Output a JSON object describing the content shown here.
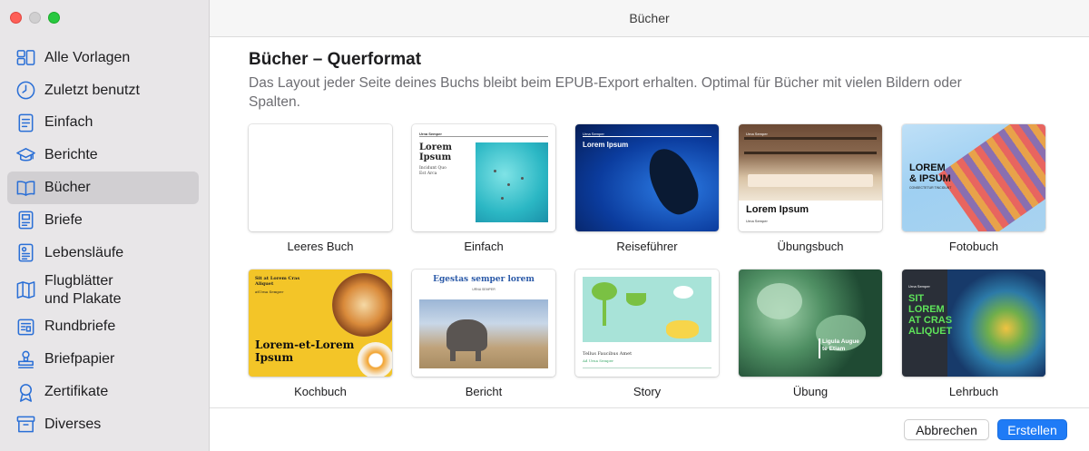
{
  "window": {
    "title": "Bücher"
  },
  "sidebar": {
    "items": [
      {
        "label": "Alle Vorlagen",
        "icon": "grid-icon"
      },
      {
        "label": "Zuletzt benutzt",
        "icon": "clock-icon"
      },
      {
        "label": "Einfach",
        "icon": "document-icon"
      },
      {
        "label": "Berichte",
        "icon": "graduation-cap-icon"
      },
      {
        "label": "Bücher",
        "icon": "book-icon",
        "selected": true
      },
      {
        "label": "Briefe",
        "icon": "letter-icon"
      },
      {
        "label": "Lebensläufe",
        "icon": "resume-icon"
      },
      {
        "label": "Flugblätter\nund Plakate",
        "label_line1": "Flugblätter",
        "label_line2": "und Plakate",
        "icon": "map-icon"
      },
      {
        "label": "Rundbriefe",
        "icon": "newsletter-icon"
      },
      {
        "label": "Briefpapier",
        "icon": "stamp-icon"
      },
      {
        "label": "Zertifikate",
        "icon": "ribbon-icon"
      },
      {
        "label": "Diverses",
        "icon": "archive-box-icon"
      }
    ]
  },
  "main": {
    "section_title": "Bücher – Querformat",
    "section_description": "Das Layout jeder Seite deines Buchs bleibt beim EPUB-Export erhalten. Optimal für Bücher mit vielen Bildern oder Spalten.",
    "templates": [
      {
        "label": "Leeres Buch"
      },
      {
        "label": "Einfach",
        "thumb": {
          "author": "Urna Semper",
          "title_line1": "Lorem",
          "title_line2": "Ipsum",
          "sub_line1": "Incidunt Quo",
          "sub_line2": "Est Arca"
        }
      },
      {
        "label": "Reiseführer",
        "thumb": {
          "author": "Urna Semper",
          "title": "Lorem Ipsum"
        }
      },
      {
        "label": "Übungsbuch",
        "thumb": {
          "author": "Urna Semper",
          "title": "Lorem Ipsum",
          "sub": "Urna Semper"
        }
      },
      {
        "label": "Fotobuch",
        "thumb": {
          "title_line1": "LOREM",
          "title_line2": "& IPSUM",
          "sub": "CONSECTETUR TINCIDUNT"
        }
      },
      {
        "label": "Kochbuch",
        "thumb": {
          "top_line1": "Sit at Lorem Cras",
          "top_line2": "Aliquet",
          "author": "atUrna Semper",
          "title_line1": "Lorem-et-Lorem",
          "title_line2": "Ipsum"
        }
      },
      {
        "label": "Bericht",
        "thumb": {
          "title": "Egestas semper lorem",
          "sub": "URNA SEMPER"
        }
      },
      {
        "label": "Story",
        "thumb": {
          "title": "Tellus Faucibus Amet",
          "sub": "Ad Urna Semper"
        }
      },
      {
        "label": "Übung",
        "thumb": {
          "title_line1": "Ligula Augue",
          "title_line2": "te Etiam"
        }
      },
      {
        "label": "Lehrbuch",
        "thumb": {
          "author": "Urna Semper",
          "title_line1": "SIT",
          "title_line2": "LOREM",
          "title_line3": "AT CRAS",
          "title_line4": "ALIQUET"
        }
      }
    ]
  },
  "footer": {
    "cancel_label": "Abbrechen",
    "create_label": "Erstellen"
  },
  "colors": {
    "accent": "#1f7bf6",
    "sidebar_bg": "#e8e6e8",
    "sidebar_selected": "#d1cfd2",
    "icon_blue": "#2a6fd6"
  }
}
